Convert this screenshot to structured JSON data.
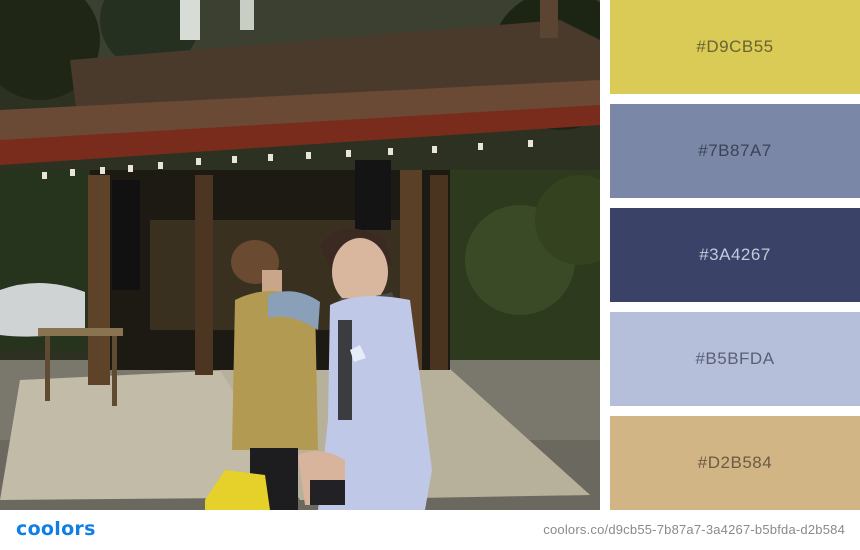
{
  "photo": {
    "alt_icon": "photo-image"
  },
  "palette": {
    "swatches": [
      {
        "hex": "#D9CB55",
        "label": "#D9CB55",
        "text_color": "#6a6333"
      },
      {
        "hex": "#7B87A7",
        "label": "#7B87A7",
        "text_color": "#3c4357"
      },
      {
        "hex": "#3A4267",
        "label": "#3A4267",
        "text_color": "#c4c9da"
      },
      {
        "hex": "#B5BFDA",
        "label": "#B5BFDA",
        "text_color": "#5a6075"
      },
      {
        "hex": "#D2B584",
        "label": "#D2B584",
        "text_color": "#6b5c44"
      }
    ]
  },
  "footer": {
    "brand": "coolors",
    "brand_color": "#0f7fe6",
    "url": "coolors.co/d9cb55-7b87a7-3a4267-b5bfda-d2b584"
  }
}
